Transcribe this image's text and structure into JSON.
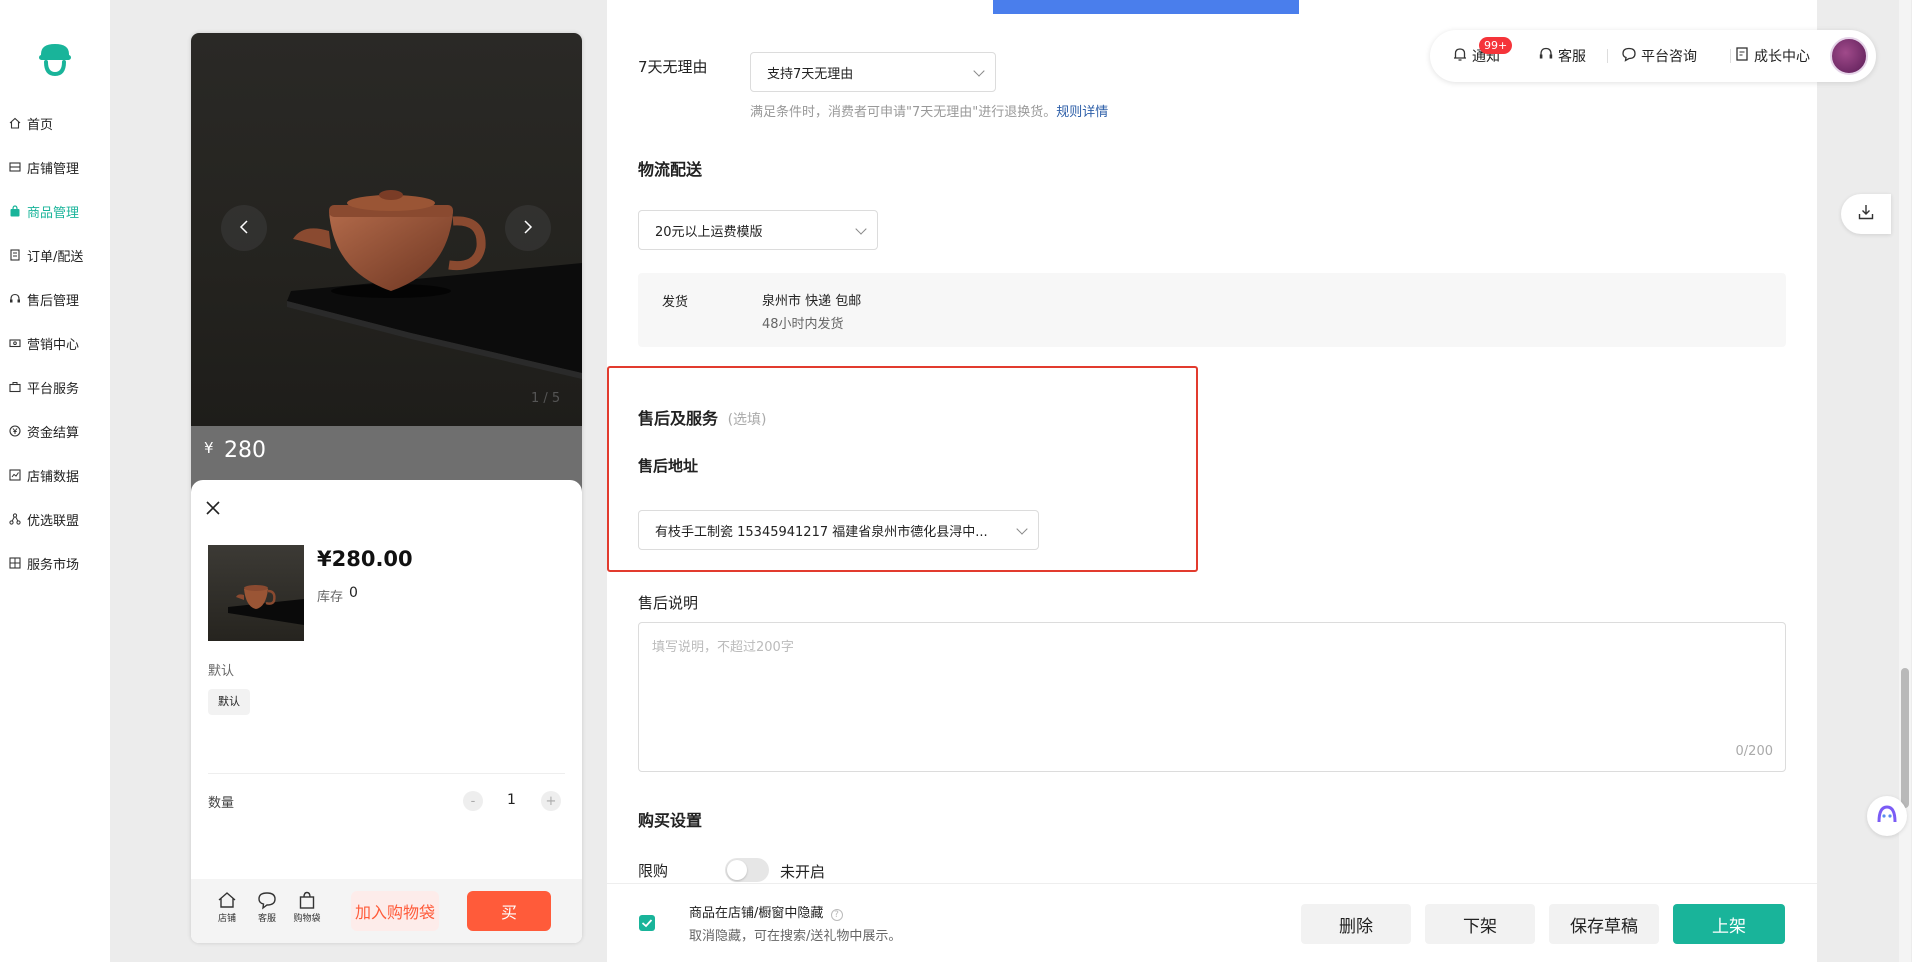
{
  "sidebar": {
    "items": [
      {
        "label": "首页"
      },
      {
        "label": "店铺管理"
      },
      {
        "label": "商品管理"
      },
      {
        "label": "订单/配送"
      },
      {
        "label": "售后管理"
      },
      {
        "label": "营销中心"
      },
      {
        "label": "平台服务"
      },
      {
        "label": "资金结算"
      },
      {
        "label": "店铺数据"
      },
      {
        "label": "优选联盟"
      },
      {
        "label": "服务市场"
      }
    ],
    "active_color": "#19b49a"
  },
  "preview": {
    "image_counter": "1 / 5",
    "price_strip": {
      "currency": "¥",
      "price": "280"
    },
    "sku": {
      "price": "¥280.00",
      "stock_label": "库存",
      "stock_value": "0",
      "spec_group": "默认",
      "spec_option": "默认",
      "quantity_label": "数量",
      "quantity_value": "1",
      "minus": "-",
      "plus": "+"
    },
    "bottom_bar": {
      "shop": "店铺",
      "service": "客服",
      "cart": "购物袋",
      "add_to_cart": "加入购物袋",
      "buy": "买"
    }
  },
  "form": {
    "seven_day": {
      "label": "7天无理由",
      "value": "支持7天无理由",
      "hint": "满足条件时，消费者可申请\"7天无理由\"进行退换货。",
      "link": "规则详情"
    },
    "logistics": {
      "title": "物流配送",
      "template": "20元以上运费模版",
      "ship_label": "发货",
      "ship_info": "泉州市 快递 包邮",
      "ship_time": "48小时内发货"
    },
    "after_sales": {
      "title": "售后及服务",
      "optional": "(选填)",
      "address_title": "售后地址",
      "address_value": "有枝手工制瓷 15345941217 福建省泉州市德化县浔中...",
      "desc_label": "售后说明",
      "desc_placeholder": "填写说明，不超过200字",
      "desc_counter": "0/200"
    },
    "purchase": {
      "title": "购买设置",
      "limit_label": "限购",
      "limit_state": "未开启"
    }
  },
  "footer": {
    "hide_label": "商品在店铺/橱窗中隐藏",
    "hide_hint": "取消隐藏，可在搜索/送礼物中展示。",
    "delete": "删除",
    "unlist": "下架",
    "save_draft": "保存草稿",
    "publish": "上架"
  },
  "topbar": {
    "notify": "通知",
    "notify_badge": "99+",
    "service": "客服",
    "consult": "平台咨询",
    "growth": "成长中心"
  },
  "colors": {
    "accent": "#19b49a",
    "highlight_border": "#e23b2e",
    "buy_button": "#ff5b3a",
    "link": "#2c5ea8",
    "badge": "#f5343a"
  }
}
